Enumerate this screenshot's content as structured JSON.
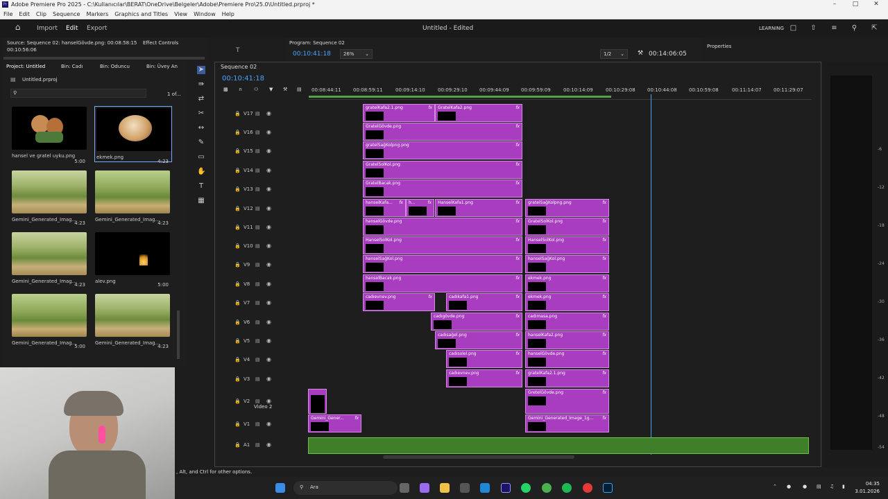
{
  "window": {
    "title": "Adobe Premiere Pro 2025 - C:\\Kullanıcılar\\BERAT\\OneDrive\\Belgeler\\Adobe\\Premiere Pro\\25.0\\Untitled.prproj *",
    "app_icon": "Pr"
  },
  "menu": [
    "File",
    "Edit",
    "Clip",
    "Sequence",
    "Markers",
    "Graphics and Titles",
    "View",
    "Window",
    "Help"
  ],
  "header": {
    "tabs": [
      "Import",
      "Edit",
      "Export"
    ],
    "center_title": "Untitled - Edited",
    "learning": "LEARNING"
  },
  "source": {
    "label": "Source: Sequence 02: hanselGövde.png: 00:08:58:15",
    "timecode": "00:10:56:06",
    "effect_controls": "Effect Controls"
  },
  "program": {
    "label": "Program: Sequence 02",
    "timecode": "00:10:41:18",
    "zoom": "26%",
    "resolution": "1/2",
    "duration": "00:14:06:05"
  },
  "properties": "Properties",
  "project": {
    "tabs": [
      "Project: Untitled",
      "Bin: Cadı",
      "Bin: Oduncu",
      "Bin: Üvey An"
    ],
    "file": "Untitled.prproj",
    "count": "1 of...",
    "items": [
      {
        "name": "hansel ve gratel uyku.png",
        "duration": "5:00"
      },
      {
        "name": "ekmek.png",
        "duration": "4:23"
      },
      {
        "name": "Gemini_Generated_Imag...",
        "duration": "4:23"
      },
      {
        "name": "Gemini_Generated_Imag...",
        "duration": "4:23"
      },
      {
        "name": "Gemini_Generated_Imag...",
        "duration": "4:23"
      },
      {
        "name": "alev.png",
        "duration": "5:00"
      },
      {
        "name": "Gemini_Generated_Imag...",
        "duration": "5:00"
      },
      {
        "name": "Gemini_Generated_Imag...",
        "duration": "4:23"
      }
    ]
  },
  "timeline": {
    "sequence": "Sequence 02",
    "timecode": "00:10:41:18",
    "ruler": [
      "00:08:44:11",
      "00:08:59:11",
      "00:09:14:10",
      "00:09:29:10",
      "00:09:44:09",
      "00:09:59:09",
      "00:10:14:09",
      "00:10:29:08",
      "00:10:44:08",
      "00:10:59:08",
      "00:11:14:07",
      "00:11:29:07"
    ],
    "tracks": [
      "V17",
      "V16",
      "V15",
      "V14",
      "V13",
      "V12",
      "V11",
      "V10",
      "V9",
      "V8",
      "V7",
      "V6",
      "V5",
      "V4",
      "V3",
      "V2",
      "V1",
      "A1"
    ],
    "v2_name": "Video 2",
    "clips": {
      "v17a": "gratelKafa2.1.png",
      "v17b": "GratelKafa2.png",
      "v16": "GratelGövde.png",
      "v15": "gratelSağKolpng.png",
      "v14": "GratelSolKol.png",
      "v13": "GratelBacak.png",
      "v12a": "hanselKafa...",
      "v12b": "h...",
      "v12c": "HanselKafa1.png",
      "v12d": "gratelSağKolpng.png",
      "v11a": "hanselGövde.png",
      "v11b": "GratelSolKol.png",
      "v10a": "HanselSolKol.png",
      "v10b": "HanselSolKol.png",
      "v9a": "hanselSağKol.png",
      "v9b": "hanselSağKol.png",
      "v8a": "hanselBacak.png",
      "v8b": "ekmek.png",
      "v7a": "cadıevnev.png",
      "v7b": "cadıkafa1.png",
      "v7c": "ekmek.png",
      "v6a": "cadıgövde.png",
      "v6b": "cadımasa.png",
      "v5a": "cadısağel.png",
      "v5b": "hanselKafa2.png",
      "v4a": "cadısolel.png",
      "v4b": "hanselGövde.png",
      "v3a": "cadıevnev.png",
      "v3b": "gratelKafa2.1.png",
      "v2b": "GretelGövde.png",
      "v1a": "Gemini_Gener...",
      "v1b": "Gemini_Generated_Image_1g..."
    },
    "fx": "fx"
  },
  "meters": [
    "-6",
    "-12",
    "-18",
    "-24",
    "-30",
    "-36",
    "-42",
    "-48",
    "-54"
  ],
  "status_hint": ", Alt, and Ctrl for other options.",
  "taskbar": {
    "search": "Ara",
    "time": "04:35",
    "date": "3.01.2026"
  }
}
